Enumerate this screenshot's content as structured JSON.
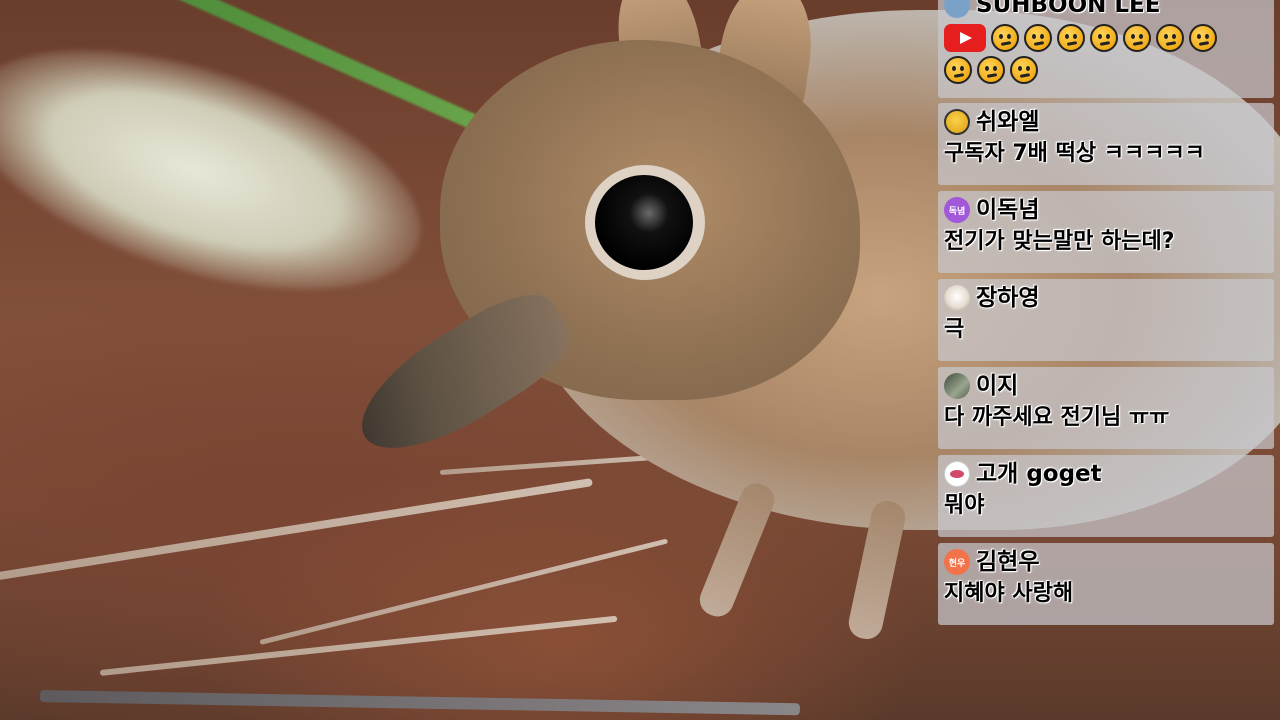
{
  "chat": {
    "messages": [
      {
        "username": "SUHBOON LEE",
        "message": "",
        "avatar_text": "",
        "avatar_style": "av-top",
        "has_youtube_icon": true,
        "emoji_count_row1": 7,
        "emoji_count_row2": 3
      },
      {
        "username": "쉬와엘",
        "message": "구독자 7배 떡상 ㅋㅋㅋㅋㅋ",
        "avatar_text": "",
        "avatar_style": "av-grin"
      },
      {
        "username": "이독념",
        "message": "전기가 맞는말만 하는데?",
        "avatar_text": "독념",
        "avatar_style": "av-purple"
      },
      {
        "username": "장하영",
        "message": "극",
        "avatar_text": "",
        "avatar_style": "av-cat"
      },
      {
        "username": "이지",
        "message": "다 까주세요 전기님 ㅠㅠ",
        "avatar_text": "",
        "avatar_style": "av-photo"
      },
      {
        "username": "고개 goget",
        "message": "뭐야",
        "avatar_text": "",
        "avatar_style": "av-lips"
      },
      {
        "username": "김현우",
        "message": "지혜야 사랑해",
        "avatar_text": "현우",
        "avatar_style": "av-orange"
      }
    ]
  },
  "icons": {
    "youtube": "youtube-icon",
    "emoji": "worried-face-emoji-icon"
  },
  "colors": {
    "youtube_red": "#e61e1e",
    "chat_bg": "rgba(200,200,205,0.72)"
  }
}
